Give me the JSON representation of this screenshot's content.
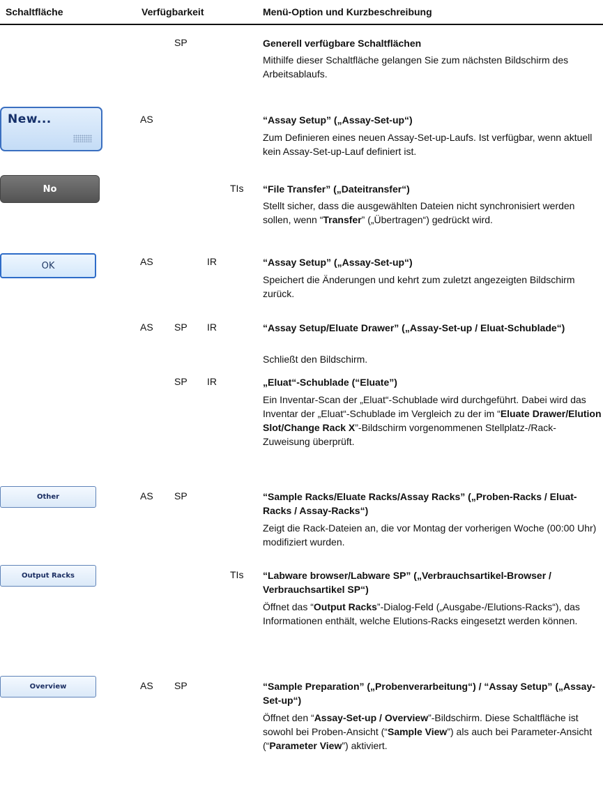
{
  "header": {
    "col1": "Schaltfläche",
    "col2": "Verfügbarkeit",
    "col3": "Menü-Option und Kurzbeschreibung"
  },
  "rows": [
    {
      "availability": [
        "SP"
      ],
      "title": "Generell verfügbare Schaltflächen",
      "description": "Mithilfe dieser Schaltfläche gelangen Sie zum nächsten Bildschirm des Arbeitsablaufs."
    },
    {
      "button": {
        "label": "New...",
        "icon": "keyboard-icon"
      },
      "availability": [
        "AS"
      ],
      "title": "“Assay Setup” („Assay-Set-up“)",
      "description": "Zum Definieren eines neuen Assay-Set-up-Laufs. Ist verfügbar, wenn aktuell kein Assay-Set-up-Lauf definiert ist."
    },
    {
      "button": {
        "label": "No"
      },
      "availability": [
        "TIs"
      ],
      "title": "“File Transfer” („Dateitransfer“)",
      "description": {
        "p1": "Stellt sicher, dass die ausgewählten Dateien nicht synchronisiert werden sollen, wenn “",
        "b1": "Transfer",
        "p2": "” („Übertragen“) gedrückt wird."
      }
    },
    {
      "button": {
        "label": "OK"
      },
      "availability": [
        "AS",
        "IR"
      ],
      "title": "“Assay Setup” („Assay-Set-up“)",
      "description": "Speichert die Änderungen und kehrt zum zuletzt angezeigten Bildschirm zurück."
    },
    {
      "availability": [
        "AS",
        "SP",
        "IR"
      ],
      "title": "“Assay Setup/Eluate Drawer” („Assay-Set-up / Eluat-Schublade“)",
      "description": "Schließt den Bildschirm."
    },
    {
      "availability": [
        "SP",
        "IR"
      ],
      "title": "„Eluat“-Schublade (“Eluate”)",
      "description": {
        "p1": "Ein Inventar-Scan der „Eluat“-Schublade wird durchgeführt. Dabei wird das Inventar der „Eluat“-Schublade im Vergleich zu der im “",
        "b1": "Eluate Drawer/Elution Slot/Change Rack X",
        "p2": "”-Bildschirm vorgenommenen Stellplatz-/Rack-Zuweisung überprüft."
      }
    },
    {
      "button": {
        "label": "Other"
      },
      "availability": [
        "AS",
        "SP"
      ],
      "title": "“Sample Racks/Eluate Racks/Assay Racks” („Proben-Racks / Eluat-Racks / Assay-Racks“)",
      "description": "Zeigt die Rack-Dateien an, die vor Montag der vorherigen Woche (00:00 Uhr) modifiziert wurden."
    },
    {
      "button": {
        "label": "Output Racks"
      },
      "availability": [
        "TIs"
      ],
      "title": "“Labware browser/Labware SP” („Verbrauchsartikel-Browser / Verbrauchsartikel SP“)",
      "description": {
        "p1": "Öffnet das “",
        "b1": "Output Racks",
        "p2": "”-Dialog-Feld („Ausgabe-/Elutions-Racks“), das Informationen enthält, welche Elutions-Racks eingesetzt werden können."
      }
    },
    {
      "button": {
        "label": "Overview"
      },
      "availability": [
        "AS",
        "SP"
      ],
      "title": "“Sample Preparation” („Probenverarbeitung“) / “Assay Setup” („Assay-Set-up“)",
      "description": {
        "p1": "Öffnet den “",
        "b1": "Assay-Set-up / Overview",
        "p2": "”-Bildschirm. Diese Schaltfläche ist sowohl bei Proben-Ansicht (“",
        "b2": "Sample View",
        "p3": "”) als auch bei Parameter-Ansicht (“",
        "b3": "Parameter View",
        "p4": "”) aktiviert."
      }
    }
  ]
}
